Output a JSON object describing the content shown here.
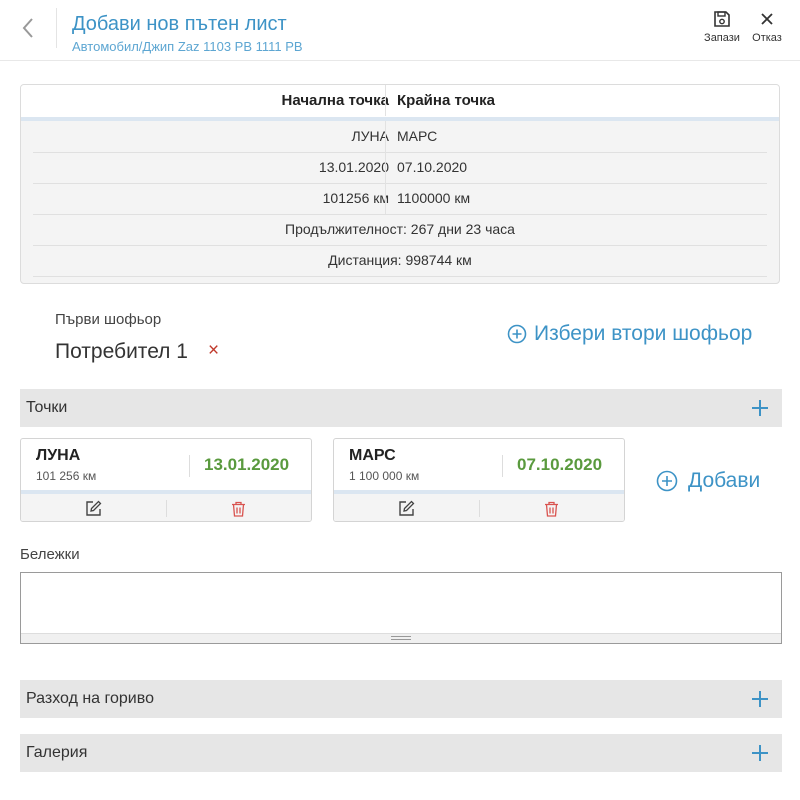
{
  "header": {
    "title": "Добави нов пътен лист",
    "subtitle": "Автомобил/Джип Zaz 1103 PB 1111 PB",
    "save_label": "Запази",
    "cancel_label": "Отказ"
  },
  "summary": {
    "start_header": "Начална точка",
    "end_header": "Крайна точка",
    "start_place": "ЛУНА",
    "end_place": "МАРС",
    "start_date": "13.01.2020",
    "end_date": "07.10.2020",
    "start_km": "101256 км",
    "end_km": "1100000 км",
    "duration": "Продължителност: 267 дни 23 часа",
    "distance": "Дистанция: 998744 км"
  },
  "drivers": {
    "first_label": "Първи шофьор",
    "first_name": "Потребител 1",
    "remove_symbol": "×",
    "second_action": "Избери втори шофьор"
  },
  "sections": {
    "points": "Точки",
    "fuel": "Разход на гориво",
    "gallery": "Галерия"
  },
  "points": [
    {
      "name": "ЛУНА",
      "km": "101 256 км",
      "date": "13.01.2020"
    },
    {
      "name": "МАРС",
      "km": "1 100 000 км",
      "date": "07.10.2020"
    }
  ],
  "add_point_label": "Добави",
  "notes": {
    "label": "Бележки",
    "value": ""
  },
  "colors": {
    "accent": "#3d93c6",
    "date_green": "#5a9a3e",
    "delete_red": "#d9534f",
    "section_bg": "#e6e6e6"
  },
  "icons": [
    "chevron-left-icon",
    "save-icon",
    "close-icon",
    "plus-circle-icon",
    "plus-icon",
    "edit-icon",
    "trash-icon"
  ]
}
